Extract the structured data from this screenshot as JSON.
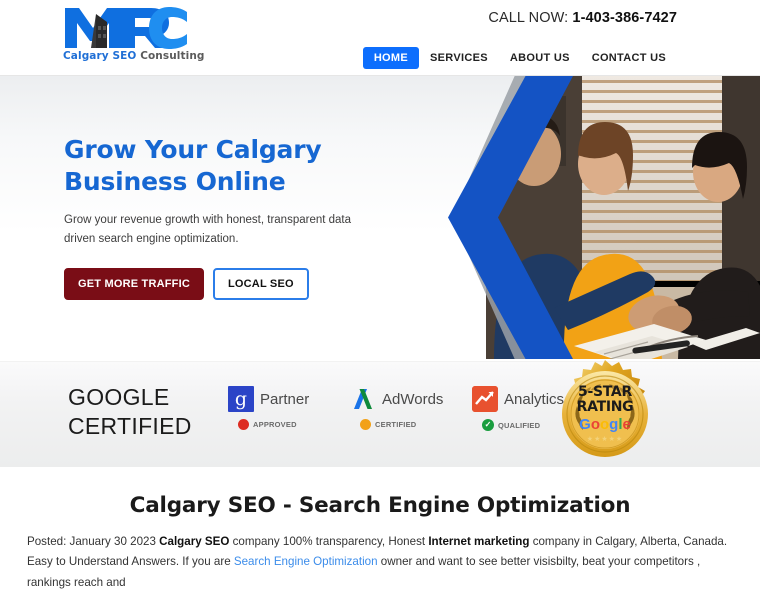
{
  "header": {
    "logo": {
      "mark_text": "MRC",
      "sub_primary": "Calgary SEO ",
      "sub_secondary": "Consulting",
      "icon": "mrc-logo-icon"
    },
    "call_label": "CALL NOW: ",
    "call_number": "1-403-386-7427",
    "nav": [
      {
        "label": "HOME",
        "active": true
      },
      {
        "label": "SERVICES",
        "active": false
      },
      {
        "label": "ABOUT US",
        "active": false
      },
      {
        "label": "CONTACT US",
        "active": false
      }
    ]
  },
  "hero": {
    "heading": "Grow Your Calgary Business Online",
    "paragraph": "Grow your revenue growth with honest, transparent data driven search engine optimization.",
    "primary_button": "GET MORE TRAFFIC",
    "secondary_button": "LOCAL SEO",
    "image_alt": "business-meeting-handshake-photo",
    "accent_blue": "#1453c4",
    "accent_grey": "#9aa0a6"
  },
  "certified": {
    "title_line1": "GOOGLE",
    "title_line2": "CERTIFIED",
    "badges": [
      {
        "icon": "google-g-icon",
        "name": "Partner",
        "status": "APPROVED",
        "status_color": "#dd2c22"
      },
      {
        "icon": "google-adwords-icon",
        "name": "AdWords",
        "status": "CERTIFIED",
        "status_color": "#f2a117"
      },
      {
        "icon": "google-analytics-icon",
        "name": "Analytics",
        "status": "QUALIFIED",
        "status_color": "#1a9d3f"
      }
    ],
    "seal": {
      "line1": "5-STAR",
      "line2": "RATING",
      "brand": "Google",
      "stars": "★★★★★",
      "gold": "#e0a521"
    }
  },
  "article": {
    "title": "Calgary SEO - Search Engine Optimization",
    "body": {
      "posted": "Posted: January 30 2023 ",
      "b1": "Calgary SEO",
      "t1": " company 100% transparency, Honest ",
      "b2": "Internet marketing",
      "t2": " company in Calgary, Alberta, Canada. Easy to Understand Answers. If you are ",
      "link": "Search Engine Optimization",
      "t3": " owner and want to see better visisbilty, beat your competitors , rankings reach and"
    }
  }
}
